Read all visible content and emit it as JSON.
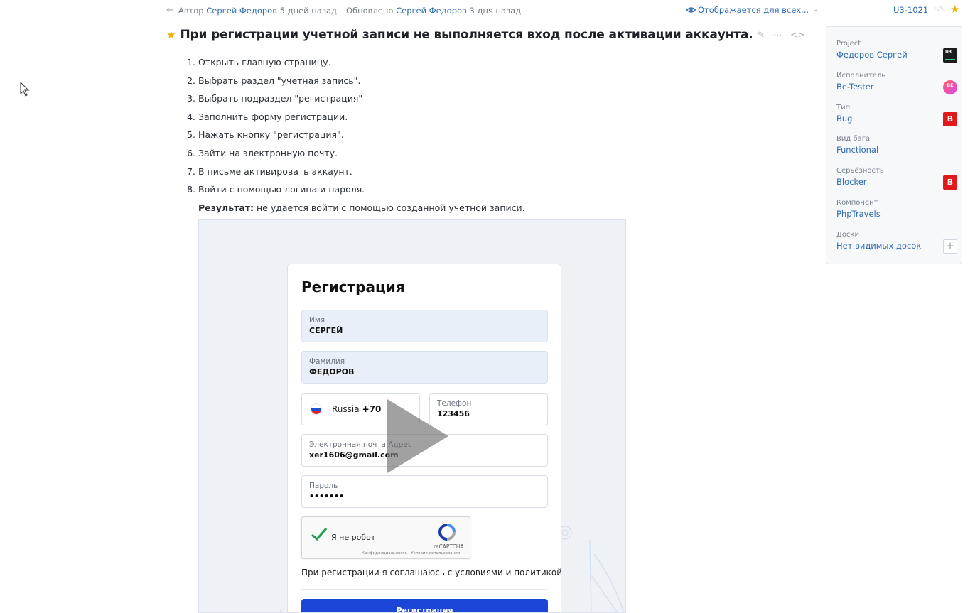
{
  "meta": {
    "author_prefix": "Автор",
    "author_name": "Сергей Федоров",
    "created_ago": "5 дней назад",
    "updated_prefix": "Обновлено",
    "updated_name": "Сергей Федоров",
    "updated_ago": "3 дня назад",
    "visibility": "Отображается для всех...",
    "issue_id": "U3-1021"
  },
  "issue": {
    "title": "При регистрации учетной записи не выполняется вход после активации аккаунта.",
    "steps": [
      "Открыть главную страницу.",
      "Выбрать раздел \"учетная запись\".",
      "Выбрать подраздел \"регистрация\"",
      "Заполнить форму регистрации.",
      "Нажать кнопку \"регистрация\".",
      "Зайти на электронную почту.",
      "В письме активировать аккаунт.",
      "Войти с помощью логина и пароля."
    ],
    "result_label": "Результат:",
    "result_text": " не удается войти с помощью созданной учетной записи."
  },
  "screenshot": {
    "form_title": "Регистрация",
    "first_name": {
      "label": "Имя",
      "value": "СЕРГЕЙ"
    },
    "last_name": {
      "label": "Фамилия",
      "value": "ФЕДОРОВ"
    },
    "country": {
      "name": "Russia",
      "code": "+70"
    },
    "phone": {
      "label": "Телефон",
      "value": "123456"
    },
    "email": {
      "label": "Электронная почта Адрес",
      "value": "xer1606@gmail.com"
    },
    "password": {
      "label": "Пароль",
      "value": "•••••••"
    },
    "captcha": {
      "text": "Я не робот",
      "brand": "reCAPTCHA",
      "footer": "Конфиденциальность - Условия использования"
    },
    "consent": "При регистрации я соглашаюсь с условиями и политикой",
    "submit": "Регистрация"
  },
  "panel": {
    "project": {
      "label": "Project",
      "value": "Федоров Сергей",
      "badge": "U3"
    },
    "assignee": {
      "label": "Исполнитель",
      "value": "Be-Tester",
      "badge": "BE"
    },
    "type": {
      "label": "Тип",
      "value": "Bug",
      "badge": "B"
    },
    "bug_kind": {
      "label": "Вид бага",
      "value": "Functional"
    },
    "severity": {
      "label": "Серьёзность",
      "value": "Blocker",
      "badge": "B"
    },
    "component": {
      "label": "Компонент",
      "value": "PhpTravels"
    },
    "boards": {
      "label": "Доски",
      "value": "Нет видимых досок"
    }
  },
  "colors": {
    "link": "#2f6db2",
    "star": "#e8b10e",
    "blocker": "#e01a1a",
    "submit": "#1b46d8"
  },
  "icons": [
    "arrow-left-icon",
    "eye-icon",
    "chevron-down-icon",
    "thumbs-up-icon",
    "star-icon",
    "pencil-icon",
    "more-icon",
    "code-icon",
    "play-icon",
    "checkmark-icon",
    "recaptcha-icon",
    "plus-icon",
    "cursor-icon"
  ]
}
